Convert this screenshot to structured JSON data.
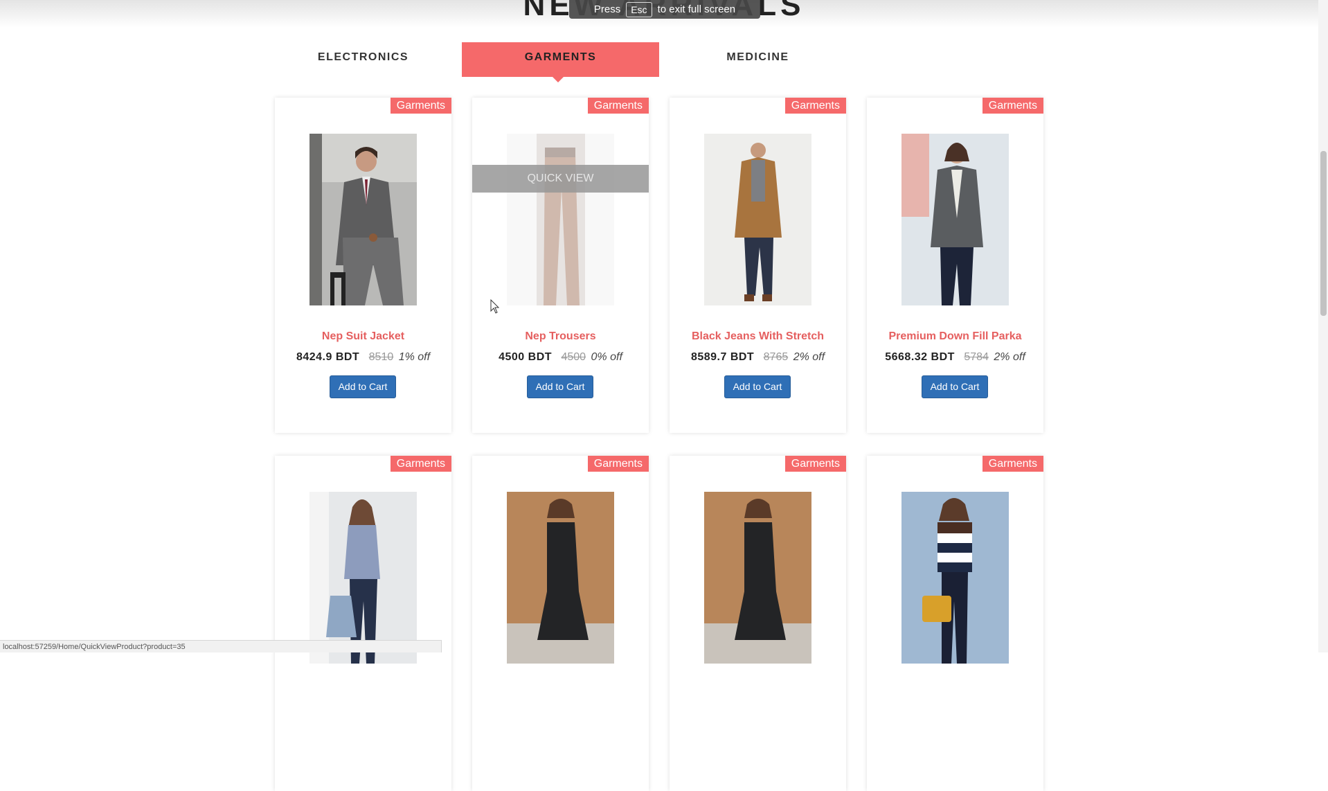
{
  "section_title": "NEW ARRIVALS",
  "fullscreen_banner": {
    "press": "Press",
    "key": "Esc",
    "suffix": "to exit full screen"
  },
  "tabs": [
    {
      "label": "ELECTRONICS",
      "active": false
    },
    {
      "label": "GARMENTS",
      "active": true
    },
    {
      "label": "MEDICINE",
      "active": false
    }
  ],
  "accent_color": "#f5696a",
  "button_color": "#2f6fb6",
  "quick_view_label": "QUICK VIEW",
  "products": [
    {
      "badge": "Garments",
      "name": "Nep Suit Jacket",
      "price": "8424.9 BDT",
      "old_price": "8510",
      "discount": "1% off",
      "button": "Add to Cart"
    },
    {
      "badge": "Garments",
      "name": "Nep Trousers",
      "price": "4500 BDT",
      "old_price": "4500",
      "discount": "0% off",
      "button": "Add to Cart"
    },
    {
      "badge": "Garments",
      "name": "Black Jeans With Stretch",
      "price": "8589.7 BDT",
      "old_price": "8765",
      "discount": "2% off",
      "button": "Add to Cart"
    },
    {
      "badge": "Garments",
      "name": "Premium Down Fill Parka",
      "price": "5668.32 BDT",
      "old_price": "5784",
      "discount": "2% off",
      "button": "Add to Cart"
    },
    {
      "badge": "Garments"
    },
    {
      "badge": "Garments"
    },
    {
      "badge": "Garments"
    },
    {
      "badge": "Garments"
    }
  ],
  "status_url": "localhost:57259/Home/QuickViewProduct?product=35"
}
